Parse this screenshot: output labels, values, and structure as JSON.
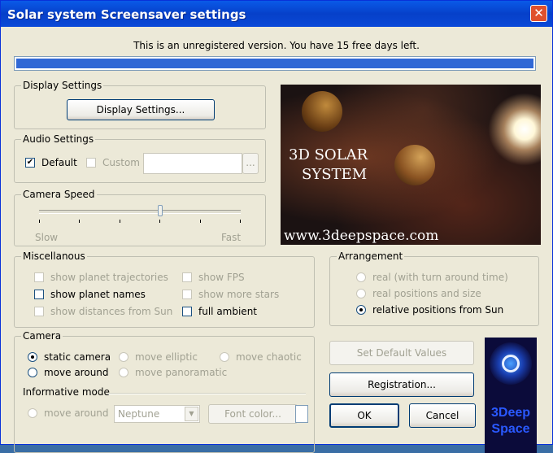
{
  "window": {
    "title": "Solar system Screensaver settings"
  },
  "status_text": "This is an unregistered version. You have 15 free days left.",
  "progress": {
    "fraction": 1.0,
    "color": "#3168d5"
  },
  "display": {
    "legend": "Display Settings",
    "button": "Display Settings..."
  },
  "audio": {
    "legend": "Audio Settings",
    "default_label": "Default",
    "default_checked": true,
    "custom_label": "Custom",
    "custom_checked": false,
    "path_value": "",
    "browse_label": "..."
  },
  "camera_speed": {
    "legend": "Camera Speed",
    "slow": "Slow",
    "fast": "Fast",
    "value": 0.6
  },
  "image": {
    "title_line1": "3D SOLAR",
    "title_line2": "SYSTEM",
    "url": "www.3deepspace.com"
  },
  "misc": {
    "legend": "Miscellanous",
    "items": [
      {
        "label": "show planet trajectories",
        "checked": false,
        "enabled": false
      },
      {
        "label": "show FPS",
        "checked": false,
        "enabled": false
      },
      {
        "label": "show planet names",
        "checked": false,
        "enabled": true
      },
      {
        "label": "show more stars",
        "checked": false,
        "enabled": false
      },
      {
        "label": "show distances from Sun",
        "checked": false,
        "enabled": false
      },
      {
        "label": "full ambient",
        "checked": false,
        "enabled": true
      }
    ]
  },
  "arrangement": {
    "legend": "Arrangement",
    "options": [
      {
        "label": "real (with turn around time)",
        "selected": false,
        "enabled": false
      },
      {
        "label": "real positions and size",
        "selected": false,
        "enabled": false
      },
      {
        "label": "relative positions from Sun",
        "selected": true,
        "enabled": true
      }
    ]
  },
  "camera": {
    "legend": "Camera",
    "options": [
      {
        "label": "static camera",
        "selected": true,
        "enabled": true
      },
      {
        "label": "move elliptic",
        "selected": false,
        "enabled": false
      },
      {
        "label": "move chaotic",
        "selected": false,
        "enabled": false
      },
      {
        "label": "move around",
        "selected": false,
        "enabled": true
      },
      {
        "label": "move panoramatic",
        "selected": false,
        "enabled": false
      }
    ],
    "informative_label": "Informative mode",
    "info_move_around": "move around",
    "planet_select": "Neptune",
    "font_color_button": "Font color...",
    "font_color_value": "#ffffff"
  },
  "buttons": {
    "set_default": "Set Default Values",
    "registration": "Registration...",
    "ok": "OK",
    "cancel": "Cancel"
  },
  "logo": {
    "text_line1": "3Deep",
    "text_line2": "Space"
  },
  "icons": {
    "close": "close-icon",
    "check": "check-icon",
    "dropdown": "chevron-down-icon"
  }
}
